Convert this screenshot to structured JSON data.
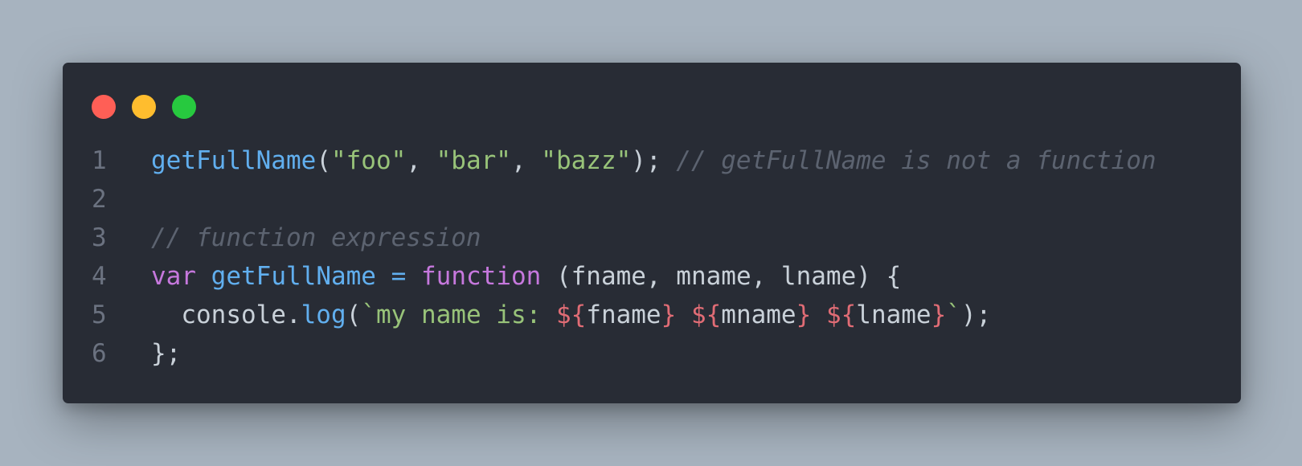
{
  "window": {
    "controls": [
      {
        "name": "close",
        "color": "#ff5f56"
      },
      {
        "name": "minimize",
        "color": "#ffbd2e"
      },
      {
        "name": "maximize",
        "color": "#27c93f"
      }
    ]
  },
  "code": {
    "lines": [
      {
        "number": "1",
        "tokens": [
          {
            "text": "getFullName",
            "kind": "fn"
          },
          {
            "text": "(",
            "kind": "pl"
          },
          {
            "text": "\"foo\"",
            "kind": "str"
          },
          {
            "text": ", ",
            "kind": "pl"
          },
          {
            "text": "\"bar\"",
            "kind": "str"
          },
          {
            "text": ", ",
            "kind": "pl"
          },
          {
            "text": "\"bazz\"",
            "kind": "str"
          },
          {
            "text": "); ",
            "kind": "pl"
          },
          {
            "text": "// getFullName is not a function",
            "kind": "cm"
          }
        ]
      },
      {
        "number": "2",
        "tokens": []
      },
      {
        "number": "3",
        "tokens": [
          {
            "text": "// function expression",
            "kind": "cm"
          }
        ]
      },
      {
        "number": "4",
        "tokens": [
          {
            "text": "var",
            "kind": "kw"
          },
          {
            "text": " ",
            "kind": "pl"
          },
          {
            "text": "getFullName",
            "kind": "fn"
          },
          {
            "text": " ",
            "kind": "pl"
          },
          {
            "text": "=",
            "kind": "fn"
          },
          {
            "text": " ",
            "kind": "pl"
          },
          {
            "text": "function",
            "kind": "kw"
          },
          {
            "text": " (fname, mname, lname) {",
            "kind": "pl"
          }
        ]
      },
      {
        "number": "5",
        "tokens": [
          {
            "text": "  console.",
            "kind": "pl"
          },
          {
            "text": "log",
            "kind": "fn"
          },
          {
            "text": "(",
            "kind": "pl"
          },
          {
            "text": "`my name is: ",
            "kind": "str"
          },
          {
            "text": "${",
            "kind": "tpl"
          },
          {
            "text": "fname",
            "kind": "pl"
          },
          {
            "text": "}",
            "kind": "tpl"
          },
          {
            "text": " ",
            "kind": "str"
          },
          {
            "text": "${",
            "kind": "tpl"
          },
          {
            "text": "mname",
            "kind": "pl"
          },
          {
            "text": "}",
            "kind": "tpl"
          },
          {
            "text": " ",
            "kind": "str"
          },
          {
            "text": "${",
            "kind": "tpl"
          },
          {
            "text": "lname",
            "kind": "pl"
          },
          {
            "text": "}",
            "kind": "tpl"
          },
          {
            "text": "`",
            "kind": "str"
          },
          {
            "text": ");",
            "kind": "pl"
          }
        ]
      },
      {
        "number": "6",
        "tokens": [
          {
            "text": "};",
            "kind": "pl"
          }
        ]
      }
    ]
  }
}
